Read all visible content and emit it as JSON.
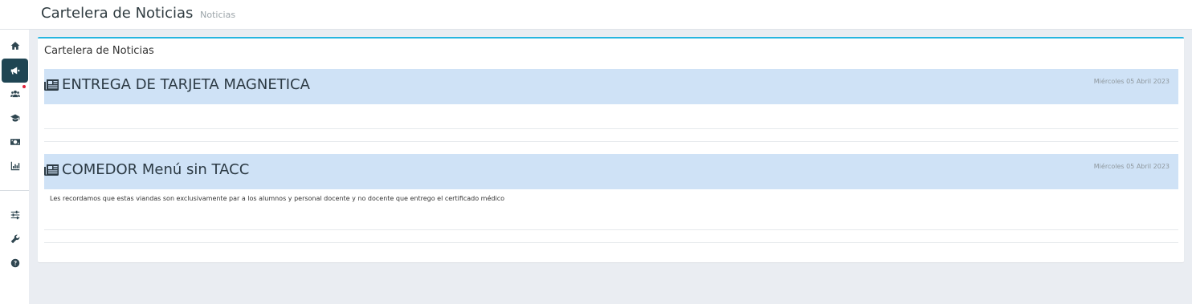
{
  "header": {
    "title": "Cartelera de Noticias",
    "subtitle": "Noticias"
  },
  "sidebar": {
    "items": [
      {
        "icon": "home-icon",
        "active": false
      },
      {
        "icon": "megaphone-icon",
        "active": true
      },
      {
        "icon": "users-icon",
        "active": false,
        "notification": true
      },
      {
        "icon": "graduation-cap-icon",
        "active": false
      },
      {
        "icon": "money-bill-icon",
        "active": false
      },
      {
        "icon": "bar-chart-icon",
        "active": false
      },
      {
        "icon": "sliders-icon",
        "active": false
      },
      {
        "icon": "wrench-icon",
        "active": false
      },
      {
        "icon": "help-circle-icon",
        "active": false
      }
    ]
  },
  "card": {
    "title": "Cartelera de Noticias",
    "accent_color": "#27b6e0"
  },
  "news": [
    {
      "icon": "newspaper-icon",
      "title": "ENTREGA DE TARJETA MAGNETICA",
      "date": "Miércoles 05 Abril 2023",
      "body": ""
    },
    {
      "icon": "newspaper-icon",
      "title": "COMEDOR Menú sin TACC",
      "date": "Miércoles 05 Abril 2023",
      "body": "Les recordamos que estas viandas son exclusivamente par a los alumnos y personal docente y no docente que entrego el certificado médico"
    }
  ],
  "colors": {
    "sidebar_active": "#1f4553",
    "news_header_bg": "#cfe2f6",
    "content_bg": "#eaedf2",
    "notification_dot": "#e0243c"
  }
}
